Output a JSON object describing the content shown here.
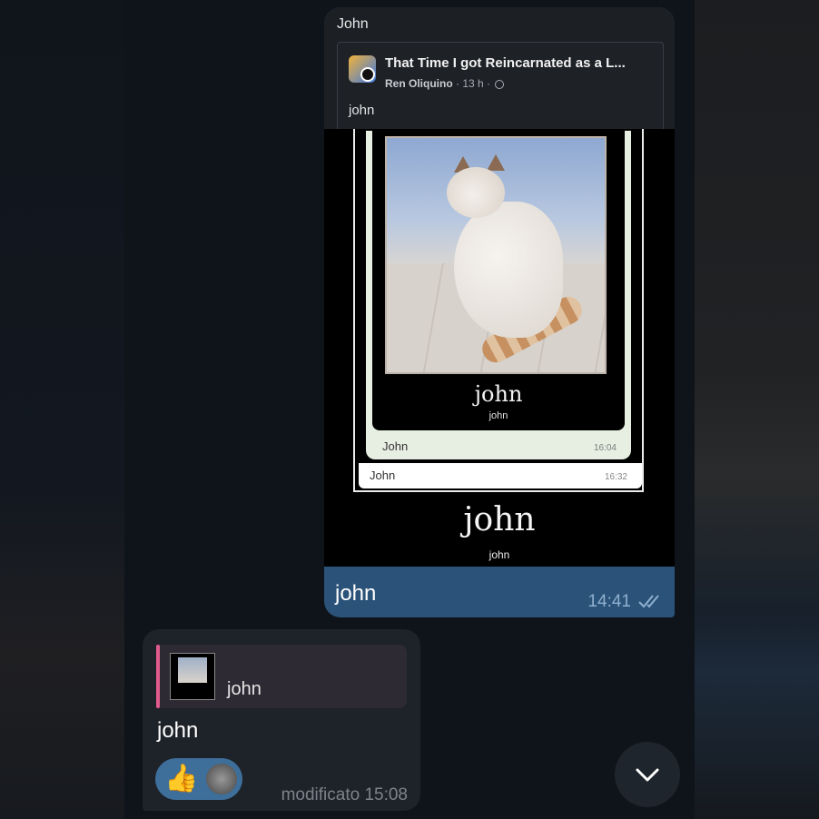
{
  "outgoing": {
    "sender": "John",
    "shared_post": {
      "title": "That Time I got Reincarnated as a L...",
      "author": "Ren Oliquino",
      "meta_age": "· 13 h ·",
      "text": "john"
    },
    "meme": {
      "inner_caption_big": "john",
      "inner_caption_small": "john",
      "inner_sender": "John",
      "inner_time": "16:04",
      "inner_reply_sender": "John",
      "inner_reply_time": "16:32",
      "caption_big": "john",
      "caption_small": "john"
    },
    "text": "john",
    "time": "14:41",
    "status_icon": "double-check-icon"
  },
  "incoming": {
    "reply_preview_text": "john",
    "text": "john",
    "reaction_emoji": "👍",
    "edited_time": "modificato 15:08"
  },
  "colors": {
    "outgoing_bubble": "#2b5278",
    "incoming_bubble": "#1e2229",
    "reply_accent": "#e05a8c",
    "background": "#0f141a"
  }
}
